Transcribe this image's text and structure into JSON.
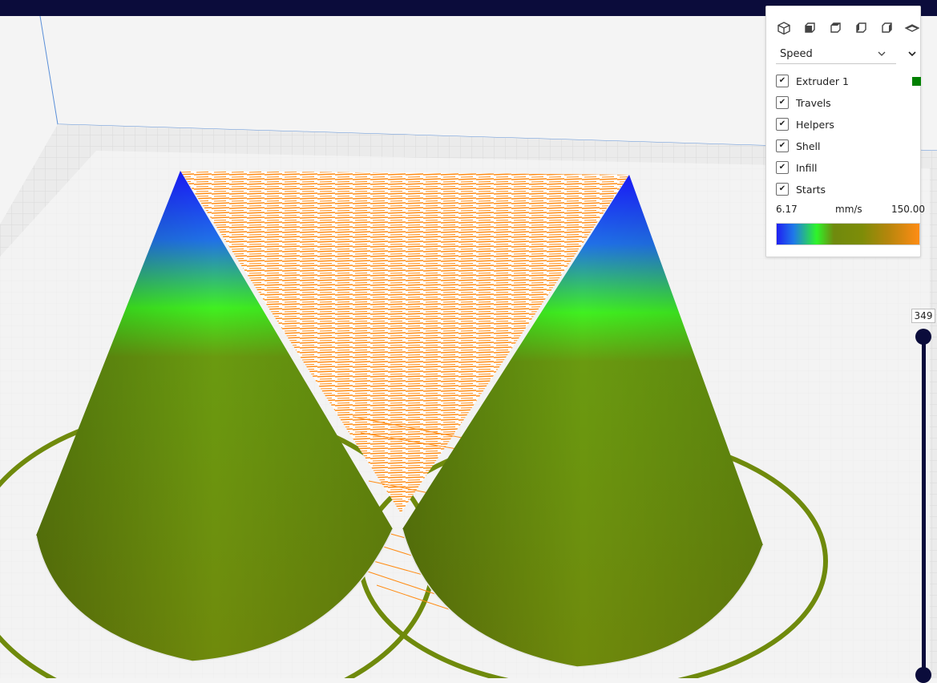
{
  "view_buttons": [
    {
      "icon": "3d-view-icon"
    },
    {
      "icon": "front-view-icon"
    },
    {
      "icon": "top-view-icon"
    },
    {
      "icon": "left-view-icon"
    },
    {
      "icon": "right-view-icon"
    },
    {
      "icon": "x-ray-view-icon"
    }
  ],
  "color_scheme": {
    "selected": "Speed"
  },
  "toggles": [
    {
      "label": "Extruder 1",
      "checked": true
    },
    {
      "label": "Travels",
      "checked": true
    },
    {
      "label": "Helpers",
      "checked": true
    },
    {
      "label": "Shell",
      "checked": true
    },
    {
      "label": "Infill",
      "checked": true
    },
    {
      "label": "Starts",
      "checked": true
    }
  ],
  "extruder_color": "#008000",
  "legend": {
    "min": "6.17",
    "unit": "mm/s",
    "max": "150.00"
  },
  "layer_slider": {
    "current_layer": "349"
  },
  "colors": {
    "topbar": "#0b0c3b",
    "travel": "#ff8c14",
    "slow": "#1f1ff2",
    "mid": "#2ff42a",
    "fast": "#7e8c08"
  }
}
